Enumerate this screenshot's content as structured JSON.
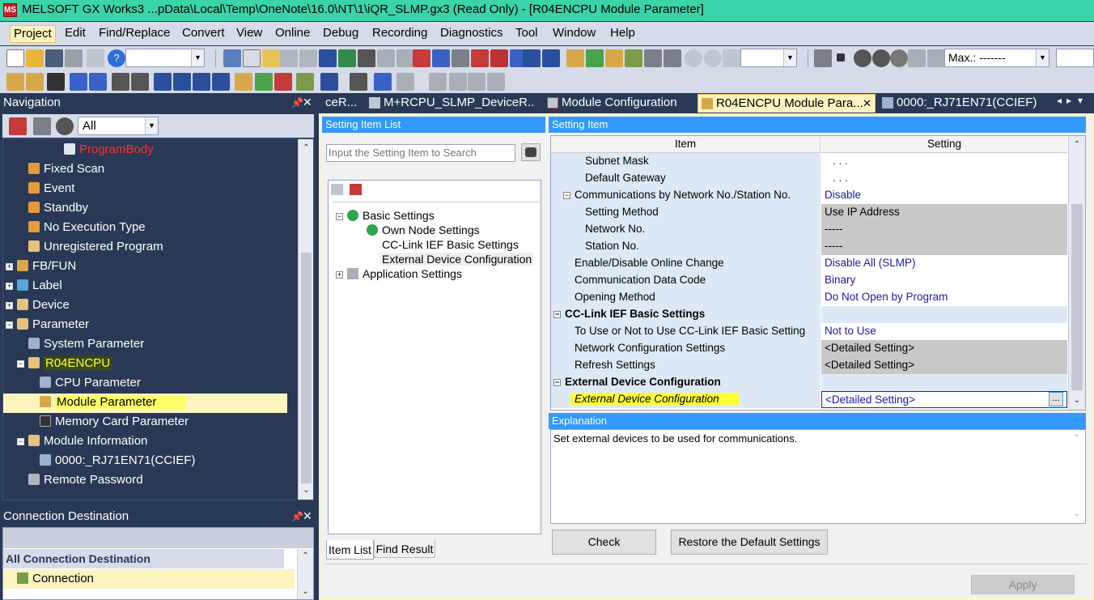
{
  "title_bar": {
    "app_icon_text": "MS",
    "text": "MELSOFT GX Works3 ...pData\\Local\\Temp\\OneNote\\16.0\\NT\\1\\iQR_SLMP.gx3 (Read Only) - [R04ENCPU Module Parameter]"
  },
  "menu": [
    "Project",
    "Edit",
    "Find/Replace",
    "Convert",
    "View",
    "Online",
    "Debug",
    "Recording",
    "Diagnostics",
    "Tool",
    "Window",
    "Help"
  ],
  "toolbar": {
    "max_label": "Max.: -------"
  },
  "navigation": {
    "title": "Navigation",
    "filter_value": "All",
    "items": [
      {
        "label": "ProgramBody"
      },
      {
        "label": "Fixed Scan"
      },
      {
        "label": "Event"
      },
      {
        "label": "Standby"
      },
      {
        "label": "No Execution Type"
      },
      {
        "label": "Unregistered Program"
      },
      {
        "label": "FB/FUN"
      },
      {
        "label": "Label"
      },
      {
        "label": "Device"
      },
      {
        "label": "Parameter"
      },
      {
        "label": "System Parameter"
      },
      {
        "label": "R04ENCPU"
      },
      {
        "label": "CPU Parameter"
      },
      {
        "label": "Module Parameter"
      },
      {
        "label": "Memory Card Parameter"
      },
      {
        "label": "Module Information"
      },
      {
        "label": "0000:_RJ71EN71(CCIEF)"
      },
      {
        "label": "Remote Password"
      }
    ]
  },
  "connection": {
    "title": "Connection Destination",
    "header": "All Connection Destination",
    "item": "Connection"
  },
  "tabs": [
    {
      "label": "ceR..."
    },
    {
      "label": "M+RCPU_SLMP_DeviceR..."
    },
    {
      "label": "Module Configuration"
    },
    {
      "label": "R04ENCPU Module Para..."
    },
    {
      "label": "0000:_RJ71EN71(CCIEF) ..."
    }
  ],
  "setting_item_list": {
    "title": "Setting Item List",
    "search_placeholder": "Input the Setting Item to Search",
    "tree": [
      "Basic Settings",
      "Own Node Settings",
      "CC-Link IEF Basic Settings",
      "External Device Configuration",
      "Application Settings"
    ],
    "bottom_tabs": [
      "Item List",
      "Find Result"
    ]
  },
  "setting_item": {
    "title": "Setting Item",
    "col_item": "Item",
    "col_setting": "Setting",
    "rows": [
      {
        "item": "Subnet Mask",
        "setting": ".    .    ."
      },
      {
        "item": "Default Gateway",
        "setting": ".    .    ."
      },
      {
        "item": "Communications by Network No./Station No.",
        "setting": "Disable"
      },
      {
        "item": "Setting Method",
        "setting": "Use IP Address"
      },
      {
        "item": "Network No.",
        "setting": "-----"
      },
      {
        "item": "Station No.",
        "setting": "-----"
      },
      {
        "item": "Enable/Disable Online Change",
        "setting": "Disable All (SLMP)"
      },
      {
        "item": "Communication Data Code",
        "setting": "Binary"
      },
      {
        "item": "Opening Method",
        "setting": "Do Not Open by Program"
      },
      {
        "item": "CC-Link IEF Basic Settings",
        "setting": ""
      },
      {
        "item": "To Use or Not to Use CC-Link IEF Basic Setting",
        "setting": "Not to Use"
      },
      {
        "item": "Network Configuration Settings",
        "setting": "<Detailed Setting>"
      },
      {
        "item": "Refresh Settings",
        "setting": "<Detailed Setting>"
      },
      {
        "item": "External Device Configuration",
        "setting": ""
      },
      {
        "item": "External Device Configuration",
        "setting": "<Detailed Setting>"
      }
    ],
    "browse_button": "..."
  },
  "explanation": {
    "title": "Explanation",
    "text": "Set external devices to be used for communications."
  },
  "buttons": {
    "check": "Check",
    "restore": "Restore the Default Settings",
    "apply": "Apply"
  },
  "colors": {
    "accent_blue": "#3399ff",
    "nav_bg": "#293955",
    "highlight": "#fdf4bf",
    "yellow_select": "#ffff66",
    "title_green": "#39d4a8"
  }
}
